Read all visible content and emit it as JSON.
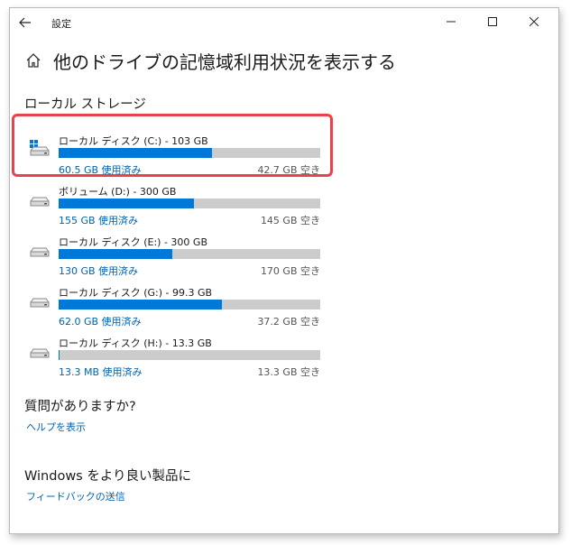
{
  "window": {
    "title": "設定"
  },
  "page": {
    "title": "他のドライブの記憶域利用状況を表示する"
  },
  "storage": {
    "section_title": "ローカル ストレージ",
    "drives": [
      {
        "name": "ローカル ディスク (C:) - 103 GB",
        "used": "60.5 GB 使用済み",
        "free": "42.7 GB 空き",
        "used_fraction": 0.587,
        "icon": "windows-drive-icon"
      },
      {
        "name": "ボリューム (D:) - 300 GB",
        "used": "155 GB 使用済み",
        "free": "145 GB 空き",
        "used_fraction": 0.517,
        "icon": "drive-icon"
      },
      {
        "name": "ローカル ディスク (E:) - 300 GB",
        "used": "130 GB 使用済み",
        "free": "170 GB 空き",
        "used_fraction": 0.433,
        "icon": "drive-icon"
      },
      {
        "name": "ローカル ディスク (G:) - 99.3 GB",
        "used": "62.0 GB 使用済み",
        "free": "37.2 GB 空き",
        "used_fraction": 0.625,
        "icon": "drive-icon"
      },
      {
        "name": "ローカル ディスク (H:) - 13.3 GB",
        "used": "13.3 MB 使用済み",
        "free": "13.3 GB 空き",
        "used_fraction": 0.001,
        "icon": "drive-icon"
      }
    ]
  },
  "help": {
    "title": "質問がありますか?",
    "link": "ヘルプを表示"
  },
  "feedback": {
    "title": "Windows をより良い製品に",
    "link": "フィードバックの送信"
  },
  "colors": {
    "accent": "#0078d7",
    "link": "#0063b1",
    "highlight": "#e8424a",
    "bar_track": "#cccccc"
  }
}
